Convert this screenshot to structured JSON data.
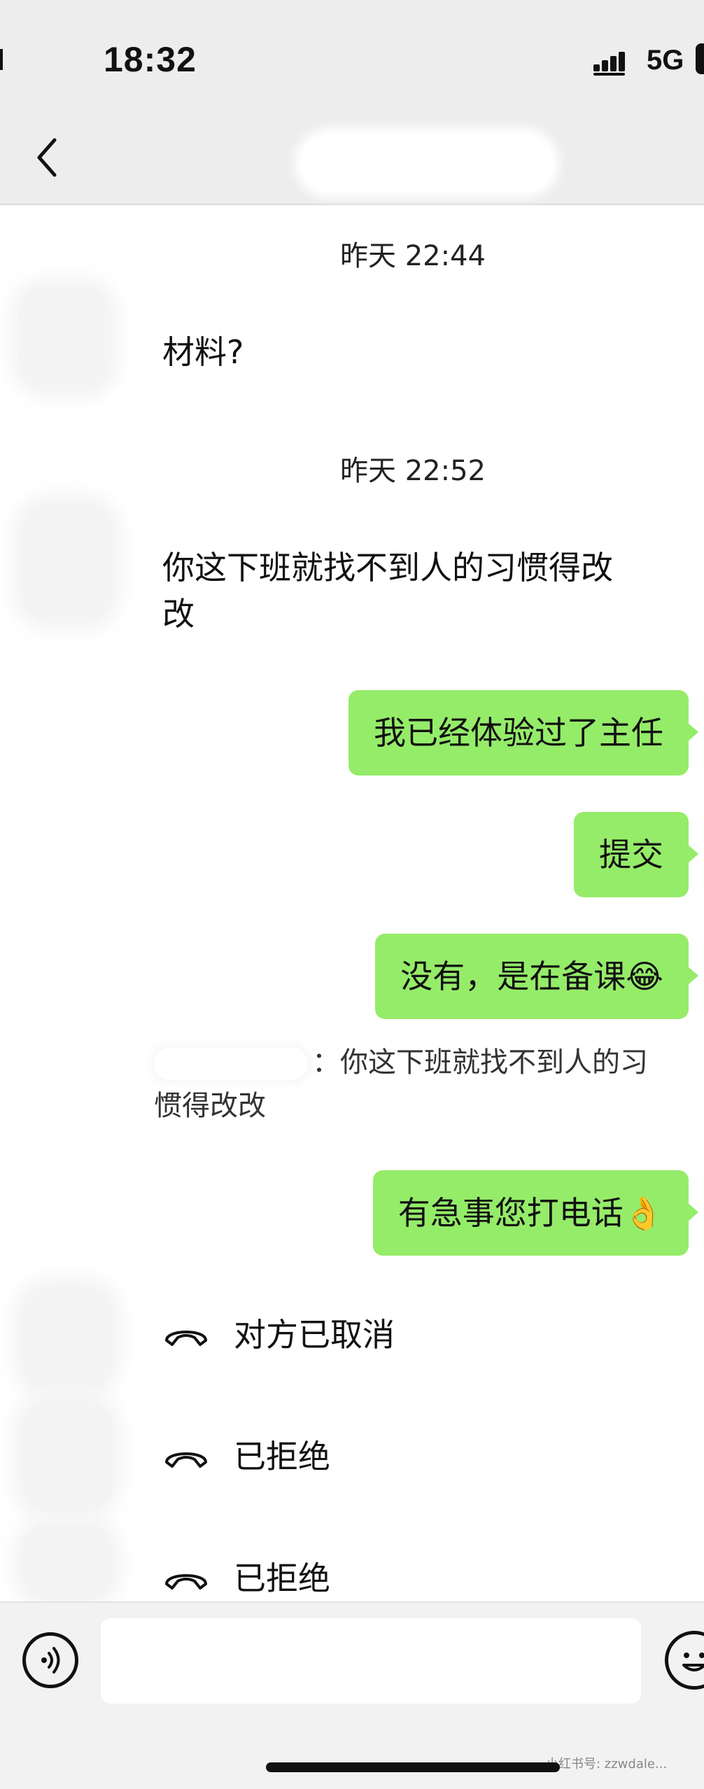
{
  "status_bar": {
    "time": "18:32",
    "network": "5G",
    "signal_icon": "signal-bars-icon"
  },
  "nav": {
    "back_icon": "chevron-left-icon",
    "title": ""
  },
  "messages": {
    "timestamp_1": "昨天 22:44",
    "incoming_1": "材料?",
    "timestamp_2": "昨天 22:52",
    "incoming_2_line1": "你这下班就找不到人的习惯得改",
    "incoming_2_line2": "改",
    "outgoing_1": "我已经体验过了主任",
    "outgoing_2": "提交",
    "outgoing_3": "没有，是在备课😂",
    "quote_separator": "：",
    "quote_line1": "你这下班就找不到人的习",
    "quote_line2": "惯得改改",
    "outgoing_4": "有急事您打电话👌",
    "call_1": "对方已取消",
    "call_2": "已拒绝",
    "call_3": "已拒绝"
  },
  "input_bar": {
    "voice_icon": "voice-input-icon",
    "placeholder": "",
    "emoji_icon": "emoji-smile-icon"
  },
  "watermark": "小红书号: zzwdale..."
}
